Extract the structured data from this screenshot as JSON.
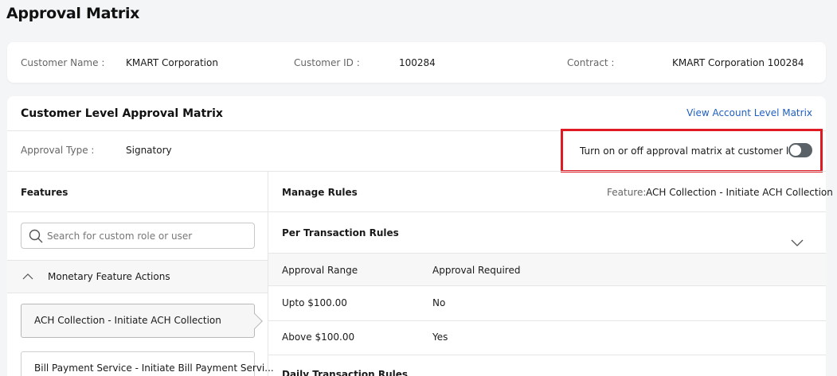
{
  "page": {
    "title": "Approval Matrix"
  },
  "customer": {
    "name_label": "Customer Name :",
    "name_value": "KMART Corporation",
    "id_label": "Customer ID :",
    "id_value": "100284",
    "contract_label": "Contract :",
    "contract_value": "KMART Corporation 100284"
  },
  "matrix": {
    "title": "Customer Level Approval Matrix",
    "view_link": "View Account Level Matrix",
    "approval_type_label": "Approval Type :",
    "approval_type_value": "Signatory",
    "toggle_label": "Turn on or off approval matrix at customer level",
    "toggle_state": "off"
  },
  "features": {
    "heading": "Features",
    "search_placeholder": "Search for custom role or user",
    "group_label": "Monetary Feature Actions",
    "items": [
      {
        "label": "ACH Collection - Initiate ACH Collection",
        "selected": true
      },
      {
        "label": "Bill Payment Service - Initiate Bill Payment Servi...",
        "selected": false
      }
    ]
  },
  "rules": {
    "heading": "Manage Rules",
    "feature_label": "Feature:",
    "feature_value": "ACH Collection - Initiate ACH Collection",
    "per_transaction_heading": "Per Transaction Rules",
    "columns": [
      "Approval Range",
      "Approval Required"
    ],
    "rows": [
      {
        "range": "Upto $100.00",
        "required": "No"
      },
      {
        "range": "Above $100.00",
        "required": "Yes"
      }
    ],
    "daily_heading": "Daily Transaction Rules"
  },
  "colors": {
    "accent_link": "#1f5fbf",
    "highlight": "#e01a22",
    "toggle_off": "#5a6268"
  }
}
